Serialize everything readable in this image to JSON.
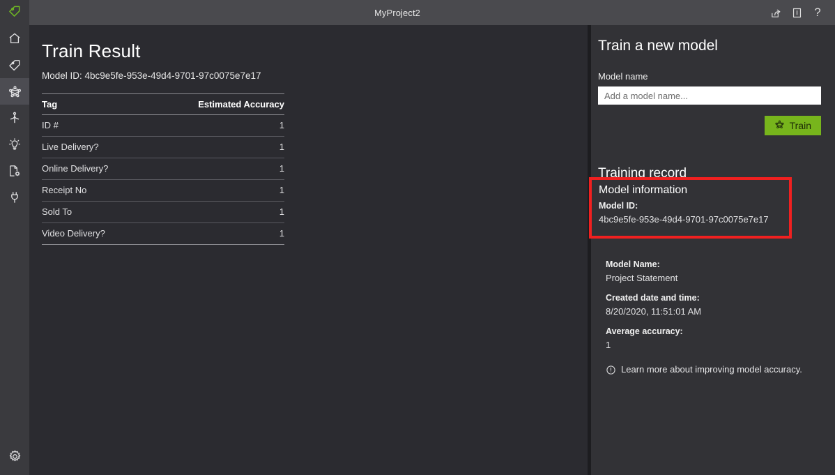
{
  "titlebar": {
    "logo_icon": "tag-logo-icon",
    "title": "MyProject2",
    "actions": [
      {
        "name": "share-icon",
        "label": "Share"
      },
      {
        "name": "book-icon",
        "label": "Documentation"
      },
      {
        "name": "help-icon",
        "label": "?"
      }
    ]
  },
  "rail": {
    "items": [
      {
        "name": "home-icon",
        "label": "Home",
        "active": false
      },
      {
        "name": "tag-icon",
        "label": "Tag",
        "active": false
      },
      {
        "name": "train-network-icon",
        "label": "Train",
        "active": true
      },
      {
        "name": "merge-icon",
        "label": "Active Learning",
        "active": false
      },
      {
        "name": "lightbulb-icon",
        "label": "Predict",
        "active": false
      },
      {
        "name": "document-settings-icon",
        "label": "Model Compose",
        "active": false
      },
      {
        "name": "plug-icon",
        "label": "Connections",
        "active": false
      }
    ],
    "settings": {
      "name": "gear-icon",
      "label": "Settings"
    }
  },
  "main": {
    "page_title": "Train Result",
    "model_id_line": "Model ID: 4bc9e5fe-953e-49d4-9701-97c0075e7e17",
    "table": {
      "columns": [
        "Tag",
        "Estimated Accuracy"
      ],
      "rows": [
        {
          "tag": "ID #",
          "accuracy": "1"
        },
        {
          "tag": "Live Delivery?",
          "accuracy": "1"
        },
        {
          "tag": "Online Delivery?",
          "accuracy": "1"
        },
        {
          "tag": "Receipt No",
          "accuracy": "1"
        },
        {
          "tag": "Sold To",
          "accuracy": "1"
        },
        {
          "tag": "Video Delivery?",
          "accuracy": "1"
        }
      ]
    }
  },
  "right_panel": {
    "train_heading": "Train a new model",
    "model_name_label": "Model name",
    "model_name_value": "",
    "model_name_placeholder": "Add a model name...",
    "train_button_label": "Train",
    "training_record_heading": "Training record",
    "model_information_heading": "Model information",
    "model_id_label": "Model ID:",
    "model_id_value": "4bc9e5fe-953e-49d4-9701-97c0075e7e17",
    "model_name_field_label": "Model Name:",
    "model_name_field_value": "Project Statement",
    "created_label": "Created date and time:",
    "created_value": "8/20/2020, 11:51:01 AM",
    "accuracy_label": "Average accuracy:",
    "accuracy_value": "1",
    "learn_more_text": "Learn more about improving model accuracy.",
    "learn_more_icon": "info-circle-icon"
  },
  "colors": {
    "accent_green": "#77b51c",
    "highlight_red": "#f02020",
    "titlebar_bg": "#4a4a4e",
    "rail_bg": "#3a3a3e",
    "content_bg": "#2b2b30",
    "panel_bg": "#323236"
  }
}
